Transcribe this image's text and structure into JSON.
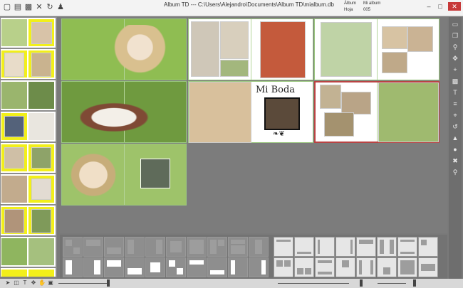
{
  "window": {
    "title": "Album TD --- C:\\Users\\Alejandro\\Documents\\Album TD\\mialbum.db",
    "info_album_label": "Álbum",
    "info_album_value": "Mi album",
    "info_page_label": "Hoja",
    "info_page_value": "005",
    "minimize": "–",
    "maximize": "□",
    "close": "✕"
  },
  "toolbar_icons": [
    "new-icon",
    "open-icon",
    "save-icon",
    "cut-icon",
    "refresh-icon",
    "user-icon"
  ],
  "spread_text": {
    "mi_boda": "Mi Boda"
  },
  "colors": {
    "accent_yellow": "#f2ef1a",
    "selected_border": "#b94343",
    "page_border": "#9ac77f",
    "grass": "#8fbd52"
  },
  "right_tools": [
    "page-icon",
    "copy-icon",
    "zoom-icon",
    "move-icon",
    "add-icon",
    "image-icon",
    "text-icon",
    "align-icon",
    "crop-icon",
    "rotate-icon",
    "flip-icon",
    "lock-icon",
    "delete-icon",
    "search-icon"
  ],
  "bottom_tools": [
    "arrow-icon",
    "bin-icon",
    "text-tool-icon",
    "pan-icon",
    "hand-icon",
    "frame-icon"
  ]
}
